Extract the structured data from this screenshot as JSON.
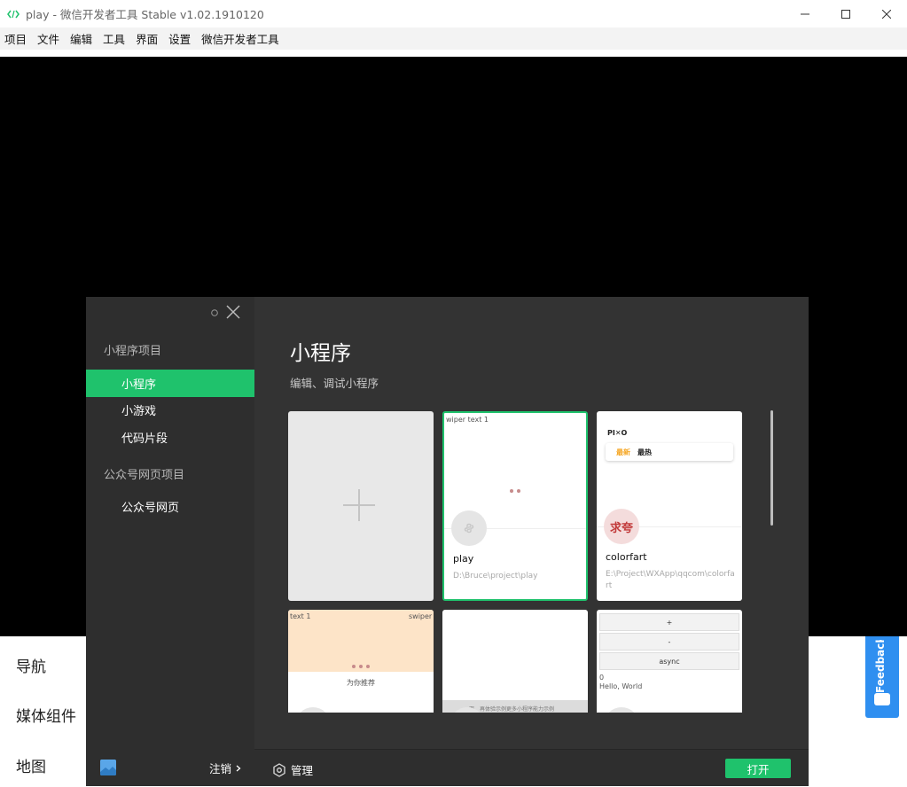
{
  "window": {
    "title": "play - 微信开发者工具 Stable v1.02.1910120"
  },
  "menu": [
    "项目",
    "文件",
    "编辑",
    "工具",
    "界面",
    "设置",
    "微信开发者工具"
  ],
  "simulator": {
    "items": [
      "导航",
      "媒体组件",
      "地图"
    ],
    "feedback": "Feedback"
  },
  "dialog": {
    "sidebar": {
      "section1": "小程序项目",
      "items1": [
        "小程序",
        "小游戏",
        "代码片段"
      ],
      "section2": "公众号网页项目",
      "items2": [
        "公众号网页"
      ],
      "logout": "注销"
    },
    "main": {
      "title": "小程序",
      "subtitle": "编辑、调试小程序",
      "projects": [
        {
          "name": "play",
          "path": "D:\\Bruce\\project\\play",
          "preview_text": "wiper text 1"
        },
        {
          "name": "colorfart",
          "path": "E:\\Project\\WXApp\\qqcom\\colorfart",
          "preview_logo": "PI✕O",
          "preview_tab_new": "最新",
          "preview_tab_hot": "最热",
          "avatar_text": "求夸"
        },
        {
          "preview_left": "text 1",
          "preview_right": "swiper t",
          "preview_caption": "为你推荐"
        },
        {
          "preview_caption": "而、再体验示例更多小程序能力示例"
        },
        {
          "preview_buttons": [
            "+",
            "-",
            "async"
          ],
          "preview_count": "0",
          "preview_hello": "Hello, World"
        }
      ],
      "manage": "管理",
      "open": "打开"
    }
  },
  "colors": {
    "accent": "#1fc26c",
    "dialog_bg": "#2e2e2e",
    "main_bg": "#333333",
    "feedback": "#2f8ff0"
  }
}
